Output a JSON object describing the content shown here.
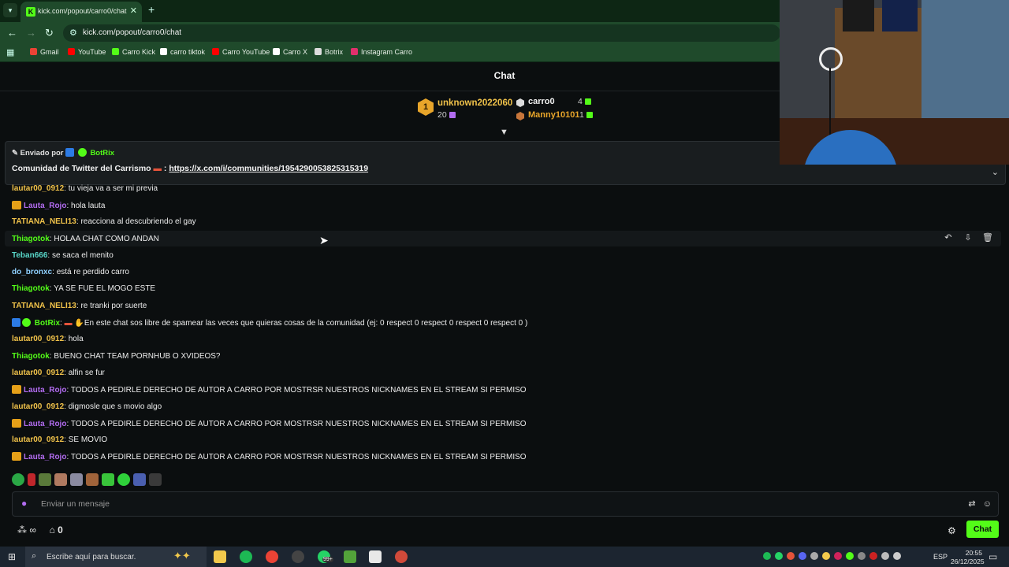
{
  "browser": {
    "tab_title": "kick.com/popout/carro0/chat",
    "url": "kick.com/popout/carro0/chat",
    "bookmarks": [
      {
        "label": "Gmail",
        "color": "#ea4335"
      },
      {
        "label": "YouTube",
        "color": "#ff0000"
      },
      {
        "label": "Carro Kick",
        "color": "#53fc18"
      },
      {
        "label": "carro tiktok",
        "color": "#ffffff"
      },
      {
        "label": "Carro YouTube",
        "color": "#ff0000"
      },
      {
        "label": "Carro X",
        "color": "#ffffff"
      },
      {
        "label": "Botrix",
        "color": "#dddddd"
      },
      {
        "label": "Instagram Carro",
        "color": "#e1306c"
      }
    ]
  },
  "chat": {
    "title": "Chat",
    "leaderboard": {
      "first": {
        "rank": "1",
        "name": "unknown2022060",
        "count": "20"
      },
      "second": {
        "name": "carro0",
        "count": "4"
      },
      "third": {
        "name": "Manny10101",
        "count": "1"
      }
    },
    "pinned": {
      "sent_by_prefix": "Enviado por",
      "sent_by": "BotRix",
      "message": "Comunidad de Twitter del Carrismo",
      "separator": ":",
      "link": "https://x.com/i/communities/1954290053825315319"
    },
    "messages": [
      {
        "user": "lautar00_0912",
        "color": "#f0c24a",
        "text": "tu vieja va a ser mi previa",
        "badge": ""
      },
      {
        "user": "Lauta_Rojo",
        "color": "#b26cf0",
        "text": "hola lauta",
        "badge": "crown"
      },
      {
        "user": "TATIANA_NELI13",
        "color": "#f0c24a",
        "text": "reacciona al descubriendo el gay",
        "badge": ""
      },
      {
        "user": "Thiagotok",
        "color": "#53fc18",
        "text": "HOLAA CHAT COMO ANDAN",
        "badge": ""
      },
      {
        "user": "Teban666",
        "color": "#58d6c8",
        "text": "se saca el menito",
        "badge": ""
      },
      {
        "user": "do_bronxc",
        "color": "#8fd0ff",
        "text": "está re perdido carro",
        "badge": ""
      },
      {
        "user": "Thiagotok",
        "color": "#53fc18",
        "text": "YA SE FUE EL MOGO ESTE",
        "badge": ""
      },
      {
        "user": "TATIANA_NELI13",
        "color": "#f0c24a",
        "text": "re tranki por suerte",
        "badge": ""
      },
      {
        "user": "BotRix",
        "color": "#53fc18",
        "text": "En este chat sos libre de spamear las veces que quieras cosas de la comunidad (ej: 0 respect 0 respect 0 respect 0 respect 0 )",
        "badge": "bot"
      },
      {
        "user": "lautar00_0912",
        "color": "#f0c24a",
        "text": "hola",
        "badge": ""
      },
      {
        "user": "Thiagotok",
        "color": "#53fc18",
        "text": "BUENO CHAT TEAM PORNHUB O XVIDEOS?",
        "badge": ""
      },
      {
        "user": "lautar00_0912",
        "color": "#f0c24a",
        "text": "alfin se fur",
        "badge": ""
      },
      {
        "user": "Lauta_Rojo",
        "color": "#b26cf0",
        "text": "TODOS A PEDIRLE DERECHO DE AUTOR A CARRO POR MOSTRSR NUESTROS NICKNAMES EN EL STREAM SI PERMISO",
        "badge": "crown"
      },
      {
        "user": "lautar00_0912",
        "color": "#f0c24a",
        "text": "digmosle que s movio algo",
        "badge": ""
      },
      {
        "user": "Lauta_Rojo",
        "color": "#b26cf0",
        "text": "TODOS A PEDIRLE DERECHO DE AUTOR A CARRO POR MOSTRSR NUESTROS NICKNAMES EN EL STREAM SI PERMISO",
        "badge": "crown"
      },
      {
        "user": "lautar00_0912",
        "color": "#f0c24a",
        "text": "SE MOVIO",
        "badge": ""
      },
      {
        "user": "Lauta_Rojo",
        "color": "#b26cf0",
        "text": "TODOS A PEDIRLE DERECHO DE AUTOR A CARRO POR MOSTRSR NUESTROS NICKNAMES EN EL STREAM SI PERMISO",
        "badge": "crown"
      }
    ],
    "input_placeholder": "Enviar un mensaje",
    "points": "0",
    "chat_button": "Chat"
  },
  "taskbar": {
    "search_placeholder": "Escribe aquí para buscar.",
    "whatsapp_badge": "99+",
    "language": "ESP",
    "time": "20:55",
    "date": "26/12/2025"
  },
  "colors": {
    "kick_green": "#53fc18",
    "gold": "#f0c24a",
    "purple": "#b26cf0"
  }
}
